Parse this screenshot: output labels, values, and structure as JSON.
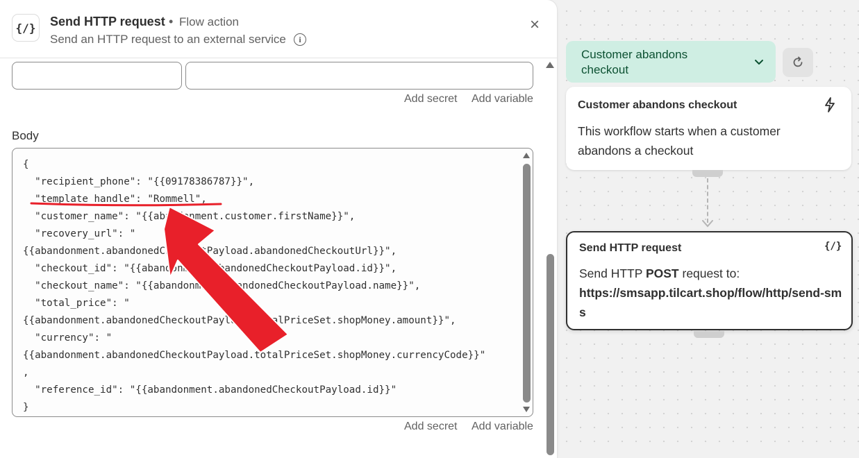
{
  "panel": {
    "header": {
      "icon": "{/}",
      "title": "Send HTTP request",
      "separator": "•",
      "tag": "Flow action",
      "subtitle": "Send an HTTP request to an external service",
      "info_icon": "i",
      "close_icon": "×"
    },
    "header_row": {
      "key_value": "",
      "value_value": ""
    },
    "links_top": {
      "add_secret": "Add secret",
      "add_variable": "Add variable"
    },
    "body": {
      "label": "Body",
      "code": "{\n  \"recipient_phone\": \"{{09178386787}}\",\n  \"template_handle\": \"Rommell\",\n  \"customer_name\": \"{{abandonment.customer.firstName}}\",\n  \"recovery_url\": \"\n{{abandonment.abandonedCheckoutPayload.abandonedCheckoutUrl}}\",\n  \"checkout_id\": \"{{abandonment.abandonedCheckoutPayload.id}}\",\n  \"checkout_name\": \"{{abandonment.abandonedCheckoutPayload.name}}\",\n  \"total_price\": \"\n{{abandonment.abandonedCheckoutPayload.totalPriceSet.shopMoney.amount}}\",\n  \"currency\": \"\n{{abandonment.abandonedCheckoutPayload.totalPriceSet.shopMoney.currencyCode}}\"\n,\n  \"reference_id\": \"{{abandonment.abandonedCheckoutPayload.id}}\"\n}"
    },
    "links_bottom": {
      "add_secret": "Add secret",
      "add_variable": "Add variable"
    }
  },
  "canvas": {
    "trigger_select": {
      "label": "Customer abandons checkout",
      "chevron_icon": "chevron-down-icon",
      "refresh_icon": "refresh-icon"
    },
    "trigger_card": {
      "title": "Customer abandons checkout",
      "icon": "lightning-bolt-icon",
      "description": "This workflow starts when a customer abandons a checkout"
    },
    "action_card": {
      "title": "Send HTTP request",
      "icon": "{/}",
      "text_prefix": "Send HTTP ",
      "method": "POST",
      "text_suffix": " request to:",
      "url": "https://smsapp.tilcart.shop/flow/http/send-sms"
    }
  },
  "colors": {
    "accent_green_bg": "#cfeee3",
    "accent_green_text": "#0c5132",
    "annotation_red": "#e8202a"
  }
}
